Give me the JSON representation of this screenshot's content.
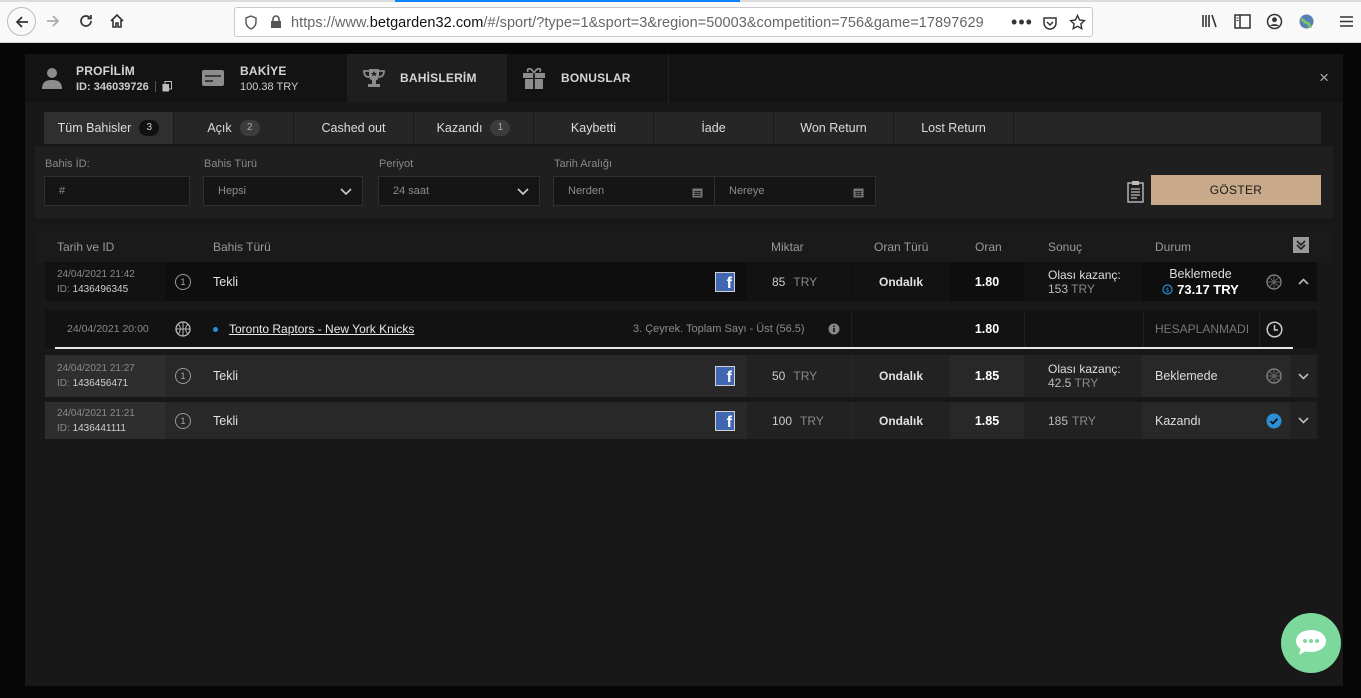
{
  "browser": {
    "url_prefix": "https://www.",
    "url_domain": "betgarden32.com",
    "url_rest": "/#/sport/?type=1&sport=3&region=50003&competition=756&game=17897629",
    "accent": "#0a84ff",
    "icons": [
      "back-arrow-icon",
      "forward-arrow-icon",
      "reload-icon",
      "home-icon",
      "shield-icon",
      "lock-icon",
      "more-icon",
      "pocket-icon",
      "star-icon",
      "library-icon",
      "sidebar-icon",
      "account-icon",
      "extension-icon",
      "menu-icon"
    ]
  },
  "top_tabs": {
    "profile": {
      "title": "PROFİLİM",
      "id": "ID: 346039726"
    },
    "balance": {
      "title": "BAKİYE",
      "value": "100.38 TRY"
    },
    "bets": {
      "title": "BAHİSLERİM"
    },
    "bonuses": {
      "title": "BONUSLAR"
    },
    "close": "×"
  },
  "sub_tabs": [
    {
      "label": "Tüm Bahisler",
      "count": "3"
    },
    {
      "label": "Açık",
      "count": "2"
    },
    {
      "label": "Cashed out",
      "count": ""
    },
    {
      "label": "Kazandı",
      "count": "1"
    },
    {
      "label": "Kaybetti",
      "count": ""
    },
    {
      "label": "İade",
      "count": ""
    },
    {
      "label": "Won Return",
      "count": ""
    },
    {
      "label": "Lost Return",
      "count": ""
    }
  ],
  "filters": {
    "bet_id_label": "Bahis İD:",
    "bet_id_placeholder": "#",
    "bet_type_label": "Bahis Türü",
    "bet_type_value": "Hepsi",
    "period_label": "Periyot",
    "period_value": "24 saat",
    "date_range_label": "Tarih Aralığı",
    "from_placeholder": "Nerden",
    "to_placeholder": "Nereye",
    "show_button": "GÖSTER",
    "button_color": "#c8a98a"
  },
  "table": {
    "headers": {
      "date_id": "Tarih ve ID",
      "bet_type": "Bahis Türü",
      "amount": "Miktar",
      "odds_type": "Oran Türü",
      "odds": "Oran",
      "result": "Sonuç",
      "status": "Durum"
    },
    "rows": [
      {
        "date": "24/04/2021 21:42",
        "id_label": "ID:",
        "id": "1436496345",
        "type_icon": "1",
        "type": "Tekli",
        "amount": "85",
        "currency": "TRY",
        "odds_type": "Ondalık",
        "odds": "1.80",
        "result_label": "Olası kazanç:",
        "result_value": "153",
        "result_currency": "TRY",
        "status": "Beklemede",
        "cashout": "73.17 TRY"
      },
      {
        "date": "24/04/2021 21:27",
        "id_label": "ID:",
        "id": "1436456471",
        "type_icon": "1",
        "type": "Tekli",
        "amount": "50",
        "currency": "TRY",
        "odds_type": "Ondalık",
        "odds": "1.85",
        "result_label": "Olası kazanç:",
        "result_value": "42.5",
        "result_currency": "TRY",
        "status": "Beklemede"
      },
      {
        "date": "24/04/2021 21:21",
        "id_label": "ID:",
        "id": "1436441111",
        "type_icon": "1",
        "type": "Tekli",
        "amount": "100",
        "currency": "TRY",
        "odds_type": "Ondalık",
        "odds": "1.85",
        "result_value": "185",
        "result_currency": "TRY",
        "status": "Kazandı"
      }
    ],
    "detail": {
      "date": "24/04/2021 20:00",
      "match": "Toronto Raptors - New York Knicks",
      "market": "3. Çeyrek. Toplam Sayı - Üst (56.5)",
      "odds": "1.80",
      "status": "HESAPLANMADI"
    }
  },
  "colors": {
    "win": "#2a8fd6",
    "chat": "#7dd99b",
    "facebook": "#4267b2"
  }
}
